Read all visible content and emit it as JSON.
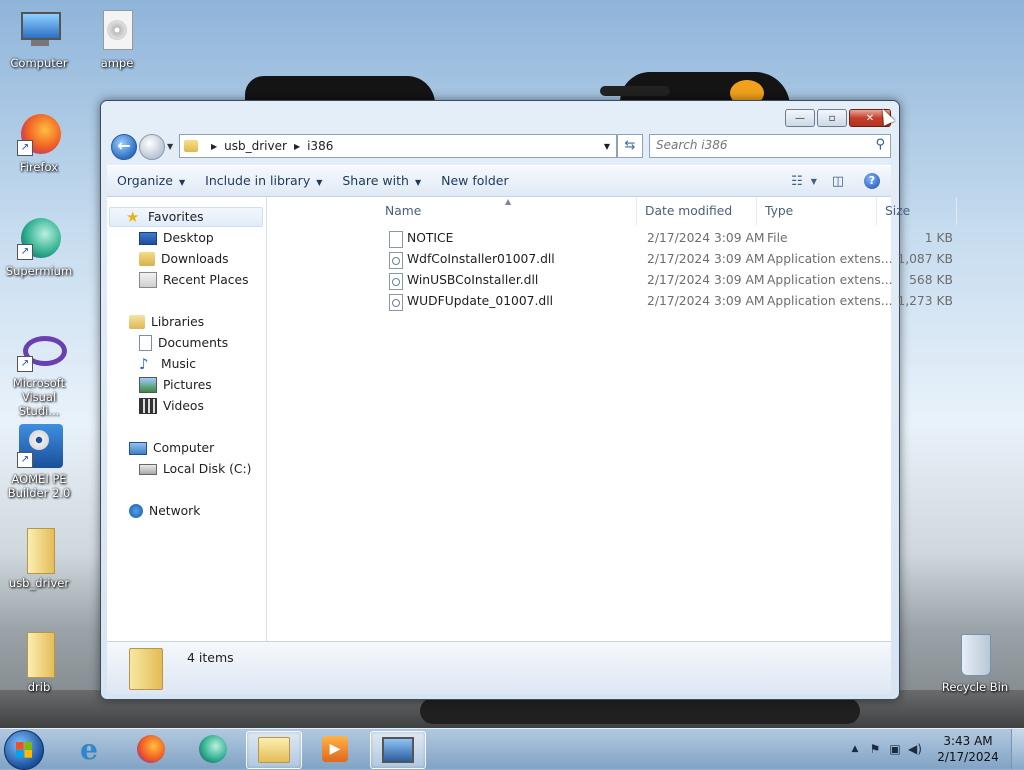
{
  "desktop": {
    "icons": [
      {
        "label": "Computer",
        "icon": "computer-icon"
      },
      {
        "label": "ampe",
        "icon": "disc-image-file-icon"
      },
      {
        "label": "Firefox",
        "icon": "firefox-icon"
      },
      {
        "label": "Supermium",
        "icon": "supermium-icon"
      },
      {
        "label": "Microsoft Visual Studi...",
        "icon": "visual-studio-icon"
      },
      {
        "label": "AOMEI PE Builder 2.0",
        "icon": "aomei-pe-builder-icon"
      },
      {
        "label": "usb_driver",
        "icon": "folder-icon"
      },
      {
        "label": "drib",
        "icon": "folder-icon"
      },
      {
        "label": "Recycle Bin",
        "icon": "recycle-bin-icon"
      }
    ]
  },
  "window": {
    "controls": {
      "minimize": "—",
      "maximize": "▫",
      "close": "✕"
    },
    "address": {
      "segments": [
        "usb_driver",
        "i386"
      ]
    },
    "search": {
      "placeholder": "Search i386"
    },
    "toolbar": {
      "organize": "Organize",
      "include_in_library": "Include in library",
      "share_with": "Share with",
      "new_folder": "New folder"
    },
    "nav": {
      "favorites": "Favorites",
      "desktop": "Desktop",
      "downloads": "Downloads",
      "recent_places": "Recent Places",
      "libraries": "Libraries",
      "documents": "Documents",
      "music": "Music",
      "pictures": "Pictures",
      "videos": "Videos",
      "computer": "Computer",
      "local_disk": "Local Disk (C:)",
      "network": "Network"
    },
    "columns": {
      "name": "Name",
      "date_modified": "Date modified",
      "type": "Type",
      "size": "Size"
    },
    "files": [
      {
        "name": "NOTICE",
        "date": "2/17/2024 3:09 AM",
        "type": "File",
        "size": "1 KB",
        "icon": "file-icon"
      },
      {
        "name": "WdfCoInstaller01007.dll",
        "date": "2/17/2024 3:09 AM",
        "type": "Application extens...",
        "size": "1,087 KB",
        "icon": "dll-file-icon"
      },
      {
        "name": "WinUSBCoInstaller.dll",
        "date": "2/17/2024 3:09 AM",
        "type": "Application extens...",
        "size": "568 KB",
        "icon": "dll-file-icon"
      },
      {
        "name": "WUDFUpdate_01007.dll",
        "date": "2/17/2024 3:09 AM",
        "type": "Application extens...",
        "size": "1,273 KB",
        "icon": "dll-file-icon"
      }
    ],
    "status": {
      "item_count": "4 items"
    }
  },
  "taskbar": {
    "apps": [
      "internet-explorer-icon",
      "firefox-icon",
      "supermium-icon",
      "file-explorer-icon",
      "media-player-icon",
      "network-computer-icon"
    ],
    "clock": {
      "time": "3:43 AM",
      "date": "2/17/2024"
    }
  }
}
